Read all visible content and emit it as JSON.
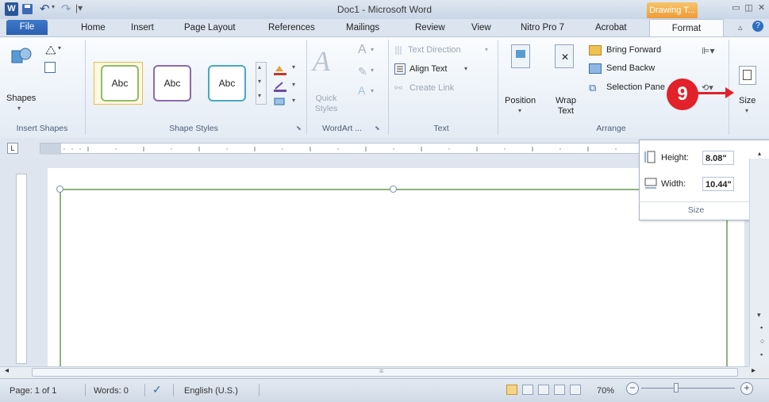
{
  "titlebar": {
    "title": "Doc1 - Microsoft Word",
    "contextual_tab": "Drawing T...",
    "word_icon": "W"
  },
  "tabs": [
    "File",
    "Home",
    "Insert",
    "Page Layout",
    "References",
    "Mailings",
    "Review",
    "View",
    "Nitro Pro 7",
    "Acrobat",
    "Format"
  ],
  "ribbon": {
    "insert_shapes": {
      "shapes_label": "Shapes",
      "group_label": "Insert Shapes"
    },
    "shape_styles": {
      "abc": [
        "Abc",
        "Abc",
        "Abc"
      ],
      "group_label": "Shape Styles"
    },
    "wordart": {
      "quick_styles": "Quick Styles",
      "group_label": "WordArt ..."
    },
    "text": {
      "text_direction": "Text Direction",
      "align_text": "Align Text",
      "create_link": "Create Link",
      "group_label": "Text"
    },
    "arrange": {
      "position": "Position",
      "wrap_text": "Wrap Text",
      "bring_forward": "Bring Forward",
      "send_backward": "Send Backw",
      "selection_pane": "Selection Pane",
      "group_label": "Arrange"
    },
    "size": {
      "label": "Size"
    }
  },
  "callout": {
    "number": "9"
  },
  "size_popup": {
    "height_label": "Height:",
    "height_value": "8.08\"",
    "width_label": "Width:",
    "width_value": "10.44\"",
    "group_label": "Size"
  },
  "statusbar": {
    "page": "Page: 1 of 1",
    "words": "Words: 0",
    "language": "English (U.S.)",
    "zoom": "70%"
  },
  "colors": {
    "accent": "#2b5797",
    "callout": "#e2212a",
    "contextual": "#ef9b38"
  }
}
